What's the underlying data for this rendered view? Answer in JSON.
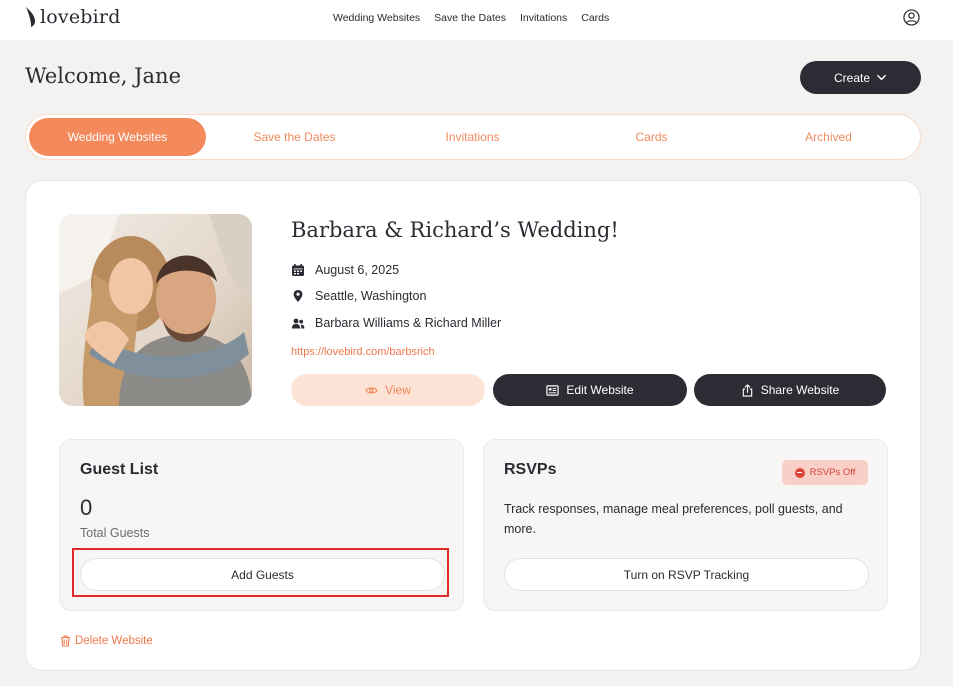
{
  "brand": {
    "name": "lovebird",
    "accent": "#f4895c",
    "dark": "#2c2c35"
  },
  "nav": {
    "links": [
      "Wedding Websites",
      "Save the Dates",
      "Invitations",
      "Cards"
    ],
    "account_icon": "user-circle-icon"
  },
  "header": {
    "welcome": "Welcome, Jane",
    "create_label": "Create"
  },
  "tabs": [
    {
      "label": "Wedding Websites",
      "active": true
    },
    {
      "label": "Save the Dates",
      "active": false
    },
    {
      "label": "Invitations",
      "active": false
    },
    {
      "label": "Cards",
      "active": false
    },
    {
      "label": "Archived",
      "active": false
    }
  ],
  "wedding": {
    "title": "Barbara & Richard’s Wedding!",
    "date": "August 6, 2025",
    "location": "Seattle, Washington",
    "couple": "Barbara Williams & Richard Miller",
    "url": "https://lovebird.com/barbsrich",
    "view_label": "View",
    "edit_label": "Edit Website",
    "share_label": "Share Website"
  },
  "guest_list": {
    "title": "Guest List",
    "count": "0",
    "count_label": "Total Guests",
    "add_label": "Add Guests"
  },
  "rsvps": {
    "title": "RSVPs",
    "status_badge": "RSVPs Off",
    "description": "Track responses, manage meal preferences, poll guests, and more.",
    "enable_label": "Turn on RSVP Tracking"
  },
  "delete_label": "Delete Website"
}
